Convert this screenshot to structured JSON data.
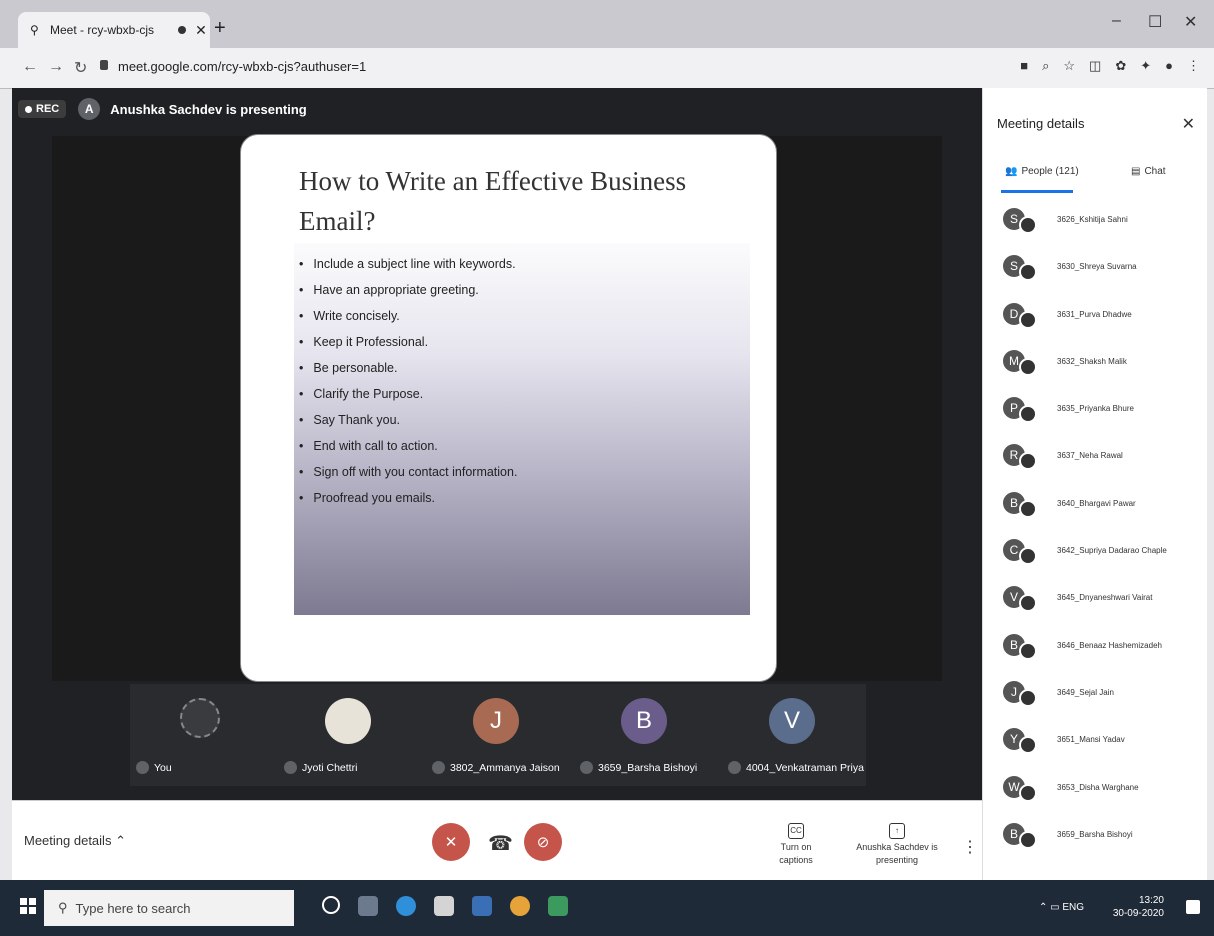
{
  "browser": {
    "tab_title": "Meet - rcy-wbxb-cjs",
    "new_tab": "+",
    "url": "meet.google.com/rcy-wbxb-cjs?authuser=1"
  },
  "meet": {
    "rec_label": "REC",
    "presenter_initial": "A",
    "presenter_banner": "Anushka Sachdev is presenting",
    "slide": {
      "title": "How to Write an Effective Business Email?",
      "bullets": [
        "Include a subject line with keywords.",
        "Have an appropriate greeting.",
        "Write concisely.",
        "Keep it Professional.",
        "Be personable.",
        "Clarify the Purpose.",
        "Say Thank you.",
        "End with call to action.",
        "Sign off with you contact information.",
        "Proofread you emails."
      ]
    },
    "tiles": [
      {
        "initial": "",
        "name": "You",
        "color": "#5f6368"
      },
      {
        "initial": "",
        "name": "Jyoti Chettri",
        "color": "#e8e3d9"
      },
      {
        "initial": "J",
        "name": "3802_Ammanya Jaison",
        "color": "#a86a52"
      },
      {
        "initial": "B",
        "name": "3659_Barsha Bishoyi",
        "color": "#6a5d8c"
      },
      {
        "initial": "V",
        "name": "4004_Venkatraman Priya",
        "color": "#5b6d8c"
      }
    ],
    "bottom": {
      "meeting_details": "Meeting details",
      "captions_icon": "CC",
      "captions_label": "Turn on captions",
      "present_label": "Anushka Sachdev is presenting"
    },
    "colors": {
      "mic_off": "#c5554a",
      "cam_off": "#c5554a"
    }
  },
  "panel": {
    "title": "Meeting details",
    "tab_people": "People (121)",
    "tab_chat": "Chat",
    "people": [
      {
        "initial": "S",
        "name": "3626_Kshitija Sahni"
      },
      {
        "initial": "S",
        "name": "3630_Shreya Suvarna"
      },
      {
        "initial": "D",
        "name": "3631_Purva Dhadwe"
      },
      {
        "initial": "M",
        "name": "3632_Shaksh Malik"
      },
      {
        "initial": "P",
        "name": "3635_Priyanka Bhure"
      },
      {
        "initial": "R",
        "name": "3637_Neha Rawal"
      },
      {
        "initial": "B",
        "name": "3640_Bhargavi Pawar"
      },
      {
        "initial": "C",
        "name": "3642_Supriya Dadarao Chaple"
      },
      {
        "initial": "V",
        "name": "3645_Dnyaneshwari Vairat"
      },
      {
        "initial": "B",
        "name": "3646_Benaaz Hashemizadeh"
      },
      {
        "initial": "J",
        "name": "3649_Sejal Jain"
      },
      {
        "initial": "Y",
        "name": "3651_Mansi Yadav"
      },
      {
        "initial": "W",
        "name": "3653_Disha Warghane"
      },
      {
        "initial": "B",
        "name": "3659_Barsha Bishoyi"
      }
    ]
  },
  "taskbar": {
    "search_placeholder": "Type here to search",
    "lang": "ENG",
    "time": "13:20",
    "date": "30-09-2020"
  }
}
